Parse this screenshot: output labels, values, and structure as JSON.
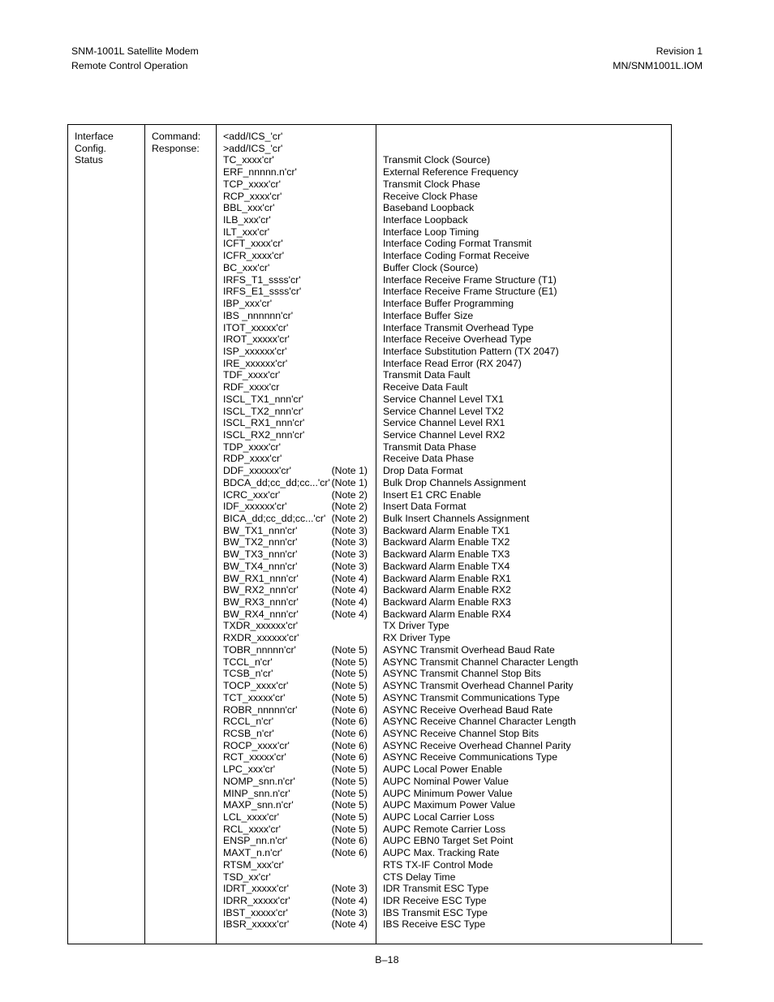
{
  "header": {
    "left_line1": "SNM-1001L Satellite Modem",
    "left_line2": "Remote Control Operation",
    "right_line1": "Revision 1",
    "right_line2": "MN/SNM1001L.IOM"
  },
  "footer": {
    "page_number": "B–18"
  },
  "table": {
    "label_lines": [
      "Interface",
      "Config.",
      "Status"
    ],
    "kind_lines": [
      "Command:",
      "Response:"
    ],
    "rows": [
      {
        "code": "<add/ICS_'cr'",
        "note": "",
        "desc": ""
      },
      {
        "code": ">add/ICS_'cr'",
        "note": "",
        "desc": ""
      },
      {
        "code": "TC_xxxx'cr'",
        "note": "",
        "desc": "Transmit Clock (Source)"
      },
      {
        "code": "ERF_nnnnn.n'cr'",
        "note": "",
        "desc": "External Reference Frequency"
      },
      {
        "code": "TCP_xxxx'cr'",
        "note": "",
        "desc": "Transmit Clock Phase"
      },
      {
        "code": "RCP_xxxx'cr'",
        "note": "",
        "desc": "Receive Clock Phase"
      },
      {
        "code": "BBL_xxx'cr'",
        "note": "",
        "desc": "Baseband Loopback"
      },
      {
        "code": "ILB_xxx'cr'",
        "note": "",
        "desc": "Interface Loopback"
      },
      {
        "code": "ILT_xxx'cr'",
        "note": "",
        "desc": "Interface Loop Timing"
      },
      {
        "code": "ICFT_xxxx'cr'",
        "note": "",
        "desc": "Interface Coding Format Transmit"
      },
      {
        "code": "ICFR_xxxx'cr'",
        "note": "",
        "desc": "Interface Coding Format Receive"
      },
      {
        "code": "BC_xxx'cr'",
        "note": "",
        "desc": "Buffer Clock (Source)"
      },
      {
        "code": "IRFS_T1_ssss'cr'",
        "note": "",
        "desc": "Interface Receive Frame Structure (T1)"
      },
      {
        "code": "IRFS_E1_ssss'cr'",
        "note": "",
        "desc": "Interface Receive Frame Structure (E1)"
      },
      {
        "code": "IBP_xxx'cr'",
        "note": "",
        "desc": "Interface Buffer Programming"
      },
      {
        "code": "IBS _nnnnnn'cr'",
        "note": "",
        "desc": "Interface Buffer Size"
      },
      {
        "code": "ITOT_xxxxx'cr'",
        "note": "",
        "desc": "Interface Transmit Overhead Type"
      },
      {
        "code": "IROT_xxxxx'cr'",
        "note": "",
        "desc": "Interface Receive Overhead Type"
      },
      {
        "code": "ISP_xxxxxx'cr'",
        "note": "",
        "desc": "Interface Substitution Pattern (TX 2047)"
      },
      {
        "code": "IRE_xxxxxx'cr'",
        "note": "",
        "desc": "Interface Read Error (RX 2047)"
      },
      {
        "code": "TDF_xxxx'cr'",
        "note": "",
        "desc": "Transmit Data Fault"
      },
      {
        "code": "RDF_xxxx'cr",
        "note": "",
        "desc": "Receive Data Fault"
      },
      {
        "code": "ISCL_TX1_nnn'cr'",
        "note": "",
        "desc": "Service Channel Level TX1"
      },
      {
        "code": "ISCL_TX2_nnn'cr'",
        "note": "",
        "desc": "Service Channel Level TX2"
      },
      {
        "code": "ISCL_RX1_nnn'cr'",
        "note": "",
        "desc": "Service Channel Level RX1"
      },
      {
        "code": "ISCL_RX2_nnn'cr'",
        "note": "",
        "desc": "Service Channel Level RX2"
      },
      {
        "code": "TDP_xxxx'cr'",
        "note": "",
        "desc": "Transmit Data Phase"
      },
      {
        "code": "RDP_xxxx'cr'",
        "note": "",
        "desc": "Receive Data Phase"
      },
      {
        "code": "DDF_xxxxxx'cr'",
        "note": "(Note 1)",
        "desc": "Drop Data Format"
      },
      {
        "code": "BDCA_dd;cc_dd;cc...'cr'",
        "note": "(Note 1)",
        "desc": "Bulk Drop Channels Assignment"
      },
      {
        "code": "ICRC_xxx'cr'",
        "note": "(Note 2)",
        "desc": "Insert E1 CRC Enable"
      },
      {
        "code": "IDF_xxxxxx'cr'",
        "note": "(Note 2)",
        "desc": "Insert Data Format"
      },
      {
        "code": "BICA_dd;cc_dd;cc...'cr'",
        "note": "(Note 2)",
        "desc": "Bulk Insert Channels Assignment"
      },
      {
        "code": "BW_TX1_nnn'cr'",
        "note": "(Note 3)",
        "desc": "Backward Alarm Enable TX1"
      },
      {
        "code": "BW_TX2_nnn'cr'",
        "note": "(Note 3)",
        "desc": "Backward Alarm Enable TX2"
      },
      {
        "code": "BW_TX3_nnn'cr'",
        "note": "(Note 3)",
        "desc": "Backward Alarm Enable TX3"
      },
      {
        "code": "BW_TX4_nnn'cr'",
        "note": "(Note 3)",
        "desc": "Backward Alarm Enable TX4"
      },
      {
        "code": "BW_RX1_nnn'cr'",
        "note": "(Note 4)",
        "desc": "Backward Alarm Enable RX1"
      },
      {
        "code": "BW_RX2_nnn'cr'",
        "note": "(Note 4)",
        "desc": "Backward Alarm Enable RX2"
      },
      {
        "code": "BW_RX3_nnn'cr'",
        "note": "(Note 4)",
        "desc": "Backward Alarm Enable RX3"
      },
      {
        "code": "BW_RX4_nnn'cr'",
        "note": "(Note 4)",
        "desc": "Backward Alarm Enable RX4"
      },
      {
        "code": "TXDR_xxxxxx'cr'",
        "note": "",
        "desc": "TX Driver Type"
      },
      {
        "code": "RXDR_xxxxxx'cr'",
        "note": "",
        "desc": "RX Driver Type"
      },
      {
        "code": "TOBR_nnnnn'cr'",
        "note": "(Note 5)",
        "desc": "ASYNC Transmit Overhead Baud Rate"
      },
      {
        "code": "TCCL_n'cr'",
        "note": "(Note 5)",
        "desc": "ASYNC Transmit Channel Character Length"
      },
      {
        "code": "TCSB_n'cr'",
        "note": "(Note 5)",
        "desc": "ASYNC Transmit Channel Stop Bits"
      },
      {
        "code": "TOCP_xxxx'cr'",
        "note": "(Note 5)",
        "desc": "ASYNC Transmit Overhead Channel Parity"
      },
      {
        "code": "TCT_xxxxx'cr'",
        "note": "(Note 5)",
        "desc": "ASYNC Transmit Communications Type"
      },
      {
        "code": "ROBR_nnnnn'cr'",
        "note": "(Note 6)",
        "desc": "ASYNC Receive Overhead Baud Rate"
      },
      {
        "code": "RCCL_n'cr'",
        "note": "(Note 6)",
        "desc": "ASYNC Receive Channel Character Length"
      },
      {
        "code": "RCSB_n'cr'",
        "note": "(Note 6)",
        "desc": "ASYNC Receive Channel Stop Bits"
      },
      {
        "code": "ROCP_xxxx'cr'",
        "note": "(Note 6)",
        "desc": "ASYNC Receive Overhead Channel Parity"
      },
      {
        "code": "RCT_xxxxx'cr'",
        "note": "(Note 6)",
        "desc": "ASYNC Receive Communications Type"
      },
      {
        "code": "LPC_xxx'cr'",
        "note": "(Note 5)",
        "desc": "AUPC Local Power Enable"
      },
      {
        "code": "NOMP_snn.n'cr'",
        "note": "(Note 5)",
        "desc": "AUPC Nominal Power Value"
      },
      {
        "code": "MINP_snn.n'cr'",
        "note": "(Note 5)",
        "desc": "AUPC Minimum Power Value"
      },
      {
        "code": "MAXP_snn.n'cr'",
        "note": "(Note 5)",
        "desc": "AUPC Maximum Power Value"
      },
      {
        "code": "LCL_xxxx'cr'",
        "note": "(Note 5)",
        "desc": "AUPC Local Carrier Loss"
      },
      {
        "code": "RCL_xxxx'cr'",
        "note": "(Note 5)",
        "desc": "AUPC Remote Carrier Loss"
      },
      {
        "code": "ENSP_nn.n'cr'",
        "note": "(Note 6)",
        "desc": "AUPC EBN0 Target Set Point"
      },
      {
        "code": "MAXT_n.n'cr'",
        "note": "(Note 6)",
        "desc": "AUPC Max. Tracking Rate"
      },
      {
        "code": "RTSM_xxx'cr'",
        "note": "",
        "desc": "RTS TX-IF Control Mode"
      },
      {
        "code": "TSD_xx'cr'",
        "note": "",
        "desc": "CTS Delay Time"
      },
      {
        "code": "IDRT_xxxxx'cr'",
        "note": "(Note 3)",
        "desc": "IDR Transmit ESC Type"
      },
      {
        "code": "IDRR_xxxxx'cr'",
        "note": "(Note 4)",
        "desc": "IDR Receive ESC Type"
      },
      {
        "code": "IBST_xxxxx'cr'",
        "note": "(Note 3)",
        "desc": "IBS Transmit ESC Type"
      },
      {
        "code": "IBSR_xxxxx'cr'",
        "note": "(Note 4)",
        "desc": "IBS Receive ESC Type"
      }
    ]
  }
}
